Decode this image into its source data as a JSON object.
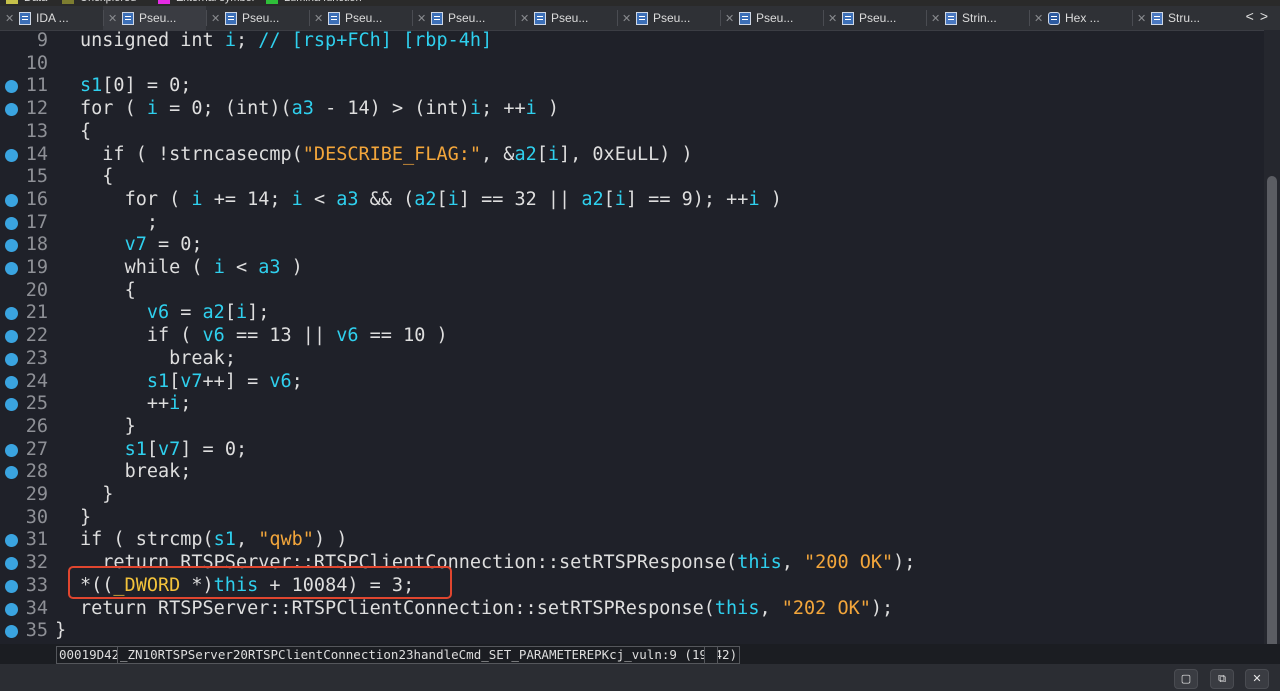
{
  "legend": [
    {
      "label": "Data",
      "color": "#c6c14a"
    },
    {
      "label": "Unexplored",
      "color": "#7d7d30"
    },
    {
      "label": "External symbol",
      "color": "#e52be5"
    },
    {
      "label": "Lumina function",
      "color": "#2fbf3a"
    }
  ],
  "tabs": [
    {
      "label": "IDA ...",
      "icon": "ida-view-icon"
    },
    {
      "label": "Pseu...",
      "icon": "pseudocode-icon",
      "active": true
    },
    {
      "label": "Pseu...",
      "icon": "pseudocode-icon"
    },
    {
      "label": "Pseu...",
      "icon": "pseudocode-icon"
    },
    {
      "label": "Pseu...",
      "icon": "pseudocode-icon"
    },
    {
      "label": "Pseu...",
      "icon": "pseudocode-icon"
    },
    {
      "label": "Pseu...",
      "icon": "pseudocode-icon"
    },
    {
      "label": "Pseu...",
      "icon": "pseudocode-icon"
    },
    {
      "label": "Pseu...",
      "icon": "pseudocode-icon"
    },
    {
      "label": "Strin...",
      "icon": "strings-icon"
    },
    {
      "label": "Hex ...",
      "icon": "hex-view-icon"
    },
    {
      "label": "Stru...",
      "icon": "structures-icon"
    }
  ],
  "nav": {
    "prev": "<",
    "next": ">"
  },
  "code_lines": [
    {
      "num": "9",
      "bp": false,
      "text": "unsigned int i; // [rsp+FCh] [rbp-4h]"
    },
    {
      "num": "10",
      "bp": false,
      "text": ""
    },
    {
      "num": "11",
      "bp": true,
      "text": "s1[0] = 0;"
    },
    {
      "num": "12",
      "bp": true,
      "text": "for ( i = 0; (int)(a3 - 14) > (int)i; ++i )"
    },
    {
      "num": "13",
      "bp": false,
      "text": "{"
    },
    {
      "num": "14",
      "bp": true,
      "text": "  if ( !strncasecmp(\"DESCRIBE_FLAG:\", &a2[i], 0xEuLL) )"
    },
    {
      "num": "15",
      "bp": false,
      "text": "  {"
    },
    {
      "num": "16",
      "bp": true,
      "text": "    for ( i += 14; i < a3 && (a2[i] == 32 || a2[i] == 9); ++i )"
    },
    {
      "num": "17",
      "bp": true,
      "text": "      ;"
    },
    {
      "num": "18",
      "bp": true,
      "text": "    v7 = 0;"
    },
    {
      "num": "19",
      "bp": true,
      "text": "    while ( i < a3 )"
    },
    {
      "num": "20",
      "bp": false,
      "text": "    {"
    },
    {
      "num": "21",
      "bp": true,
      "text": "      v6 = a2[i];"
    },
    {
      "num": "22",
      "bp": true,
      "text": "      if ( v6 == 13 || v6 == 10 )"
    },
    {
      "num": "23",
      "bp": true,
      "text": "        break;"
    },
    {
      "num": "24",
      "bp": true,
      "text": "      s1[v7++] = v6;"
    },
    {
      "num": "25",
      "bp": true,
      "text": "      ++i;"
    },
    {
      "num": "26",
      "bp": false,
      "text": "    }"
    },
    {
      "num": "27",
      "bp": true,
      "text": "    s1[v7] = 0;"
    },
    {
      "num": "28",
      "bp": true,
      "text": "    break;"
    },
    {
      "num": "29",
      "bp": false,
      "text": "  }"
    },
    {
      "num": "30",
      "bp": false,
      "text": "}"
    },
    {
      "num": "31",
      "bp": true,
      "text": "if ( strcmp(s1, \"qwb\") )"
    },
    {
      "num": "32",
      "bp": true,
      "text": "  return RTSPServer::RTSPClientConnection::setRTSPResponse(this, \"200 OK\");"
    },
    {
      "num": "33",
      "bp": true,
      "text": "*((_DWORD *)this + 10084) = 3;"
    },
    {
      "num": "34",
      "bp": true,
      "text": "return RTSPServer::RTSPClientConnection::setRTSPResponse(this, \"202 OK\");"
    },
    {
      "num": "35",
      "bp": true,
      "text": "}"
    }
  ],
  "status": {
    "address": "00019D42",
    "location": "_ZN10RTSPServer20RTSPClientConnection23handleCmd_SET_PARAMETEREPKcj_vuln:9 (19D42)"
  },
  "bottom_buttons": [
    "restore-icon",
    "detach-icon",
    "close-icon"
  ],
  "colors": {
    "background": "#1f2129",
    "variable": "#2fd0ee",
    "string": "#f3a63b",
    "breakpoint": "#3aa4e0",
    "highlight_box": "#e0462f"
  }
}
